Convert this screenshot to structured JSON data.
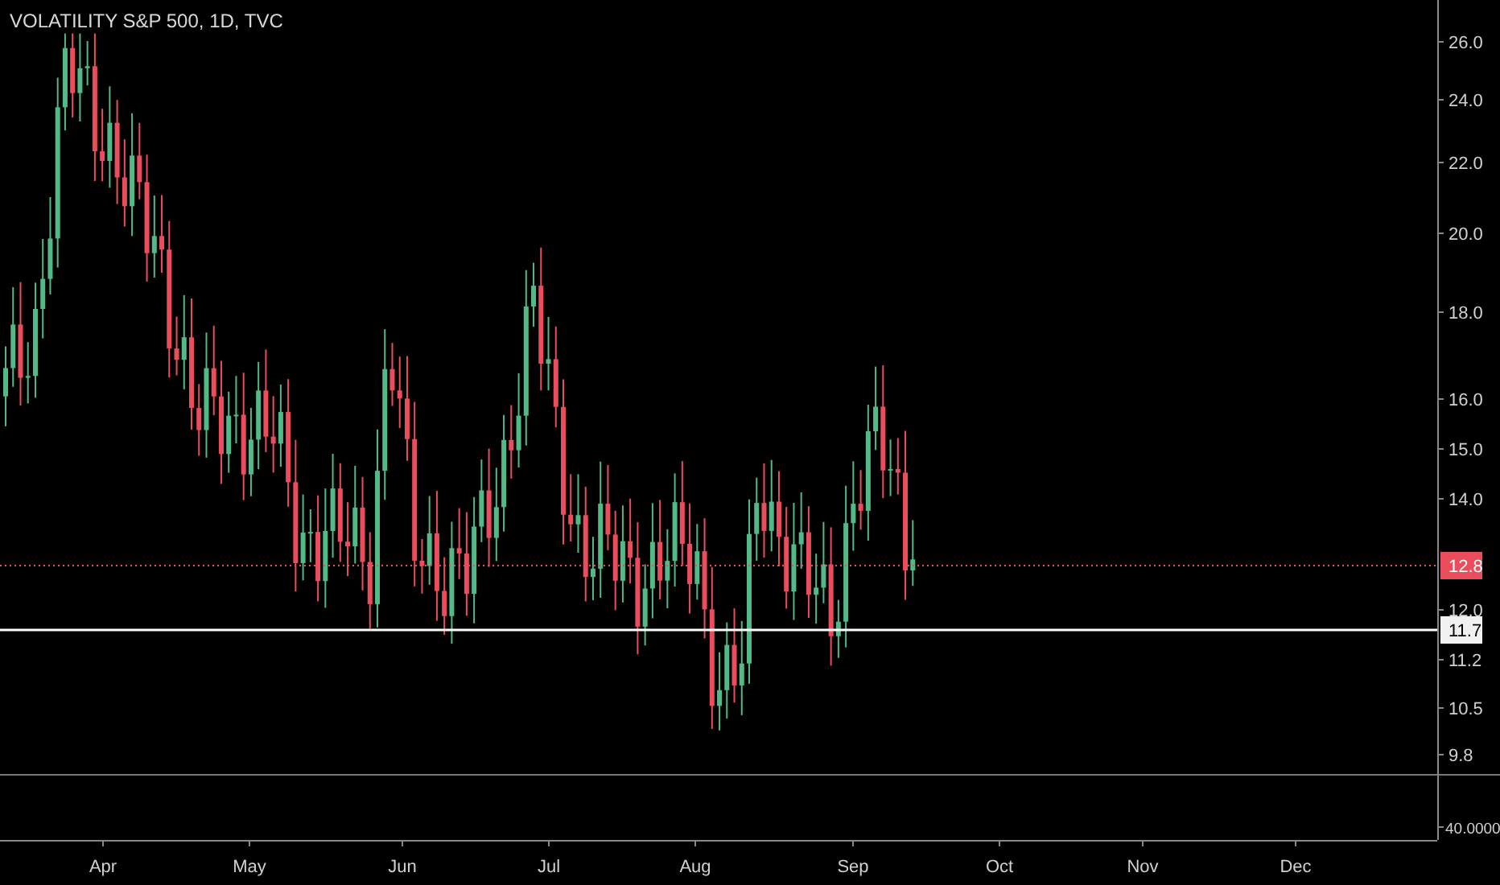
{
  "legend": {
    "title": "VOLATILITY S&P 500, 1D, TVC"
  },
  "price_axis": {
    "labels": [
      "26.0",
      "24.0",
      "22.0",
      "20.0",
      "18.0",
      "16.0",
      "15.0",
      "14.0",
      "12.0",
      "11.2",
      "10.5",
      "9.8"
    ]
  },
  "current_price_badge": "12.8",
  "horizontal_line_badge": "11.7",
  "lower_pane": {
    "axis_label": "40.0000"
  },
  "time_axis": {
    "labels": [
      "Apr",
      "May",
      "Jun",
      "Jul",
      "Aug",
      "Sep",
      "Oct",
      "Nov",
      "Dec"
    ]
  }
}
